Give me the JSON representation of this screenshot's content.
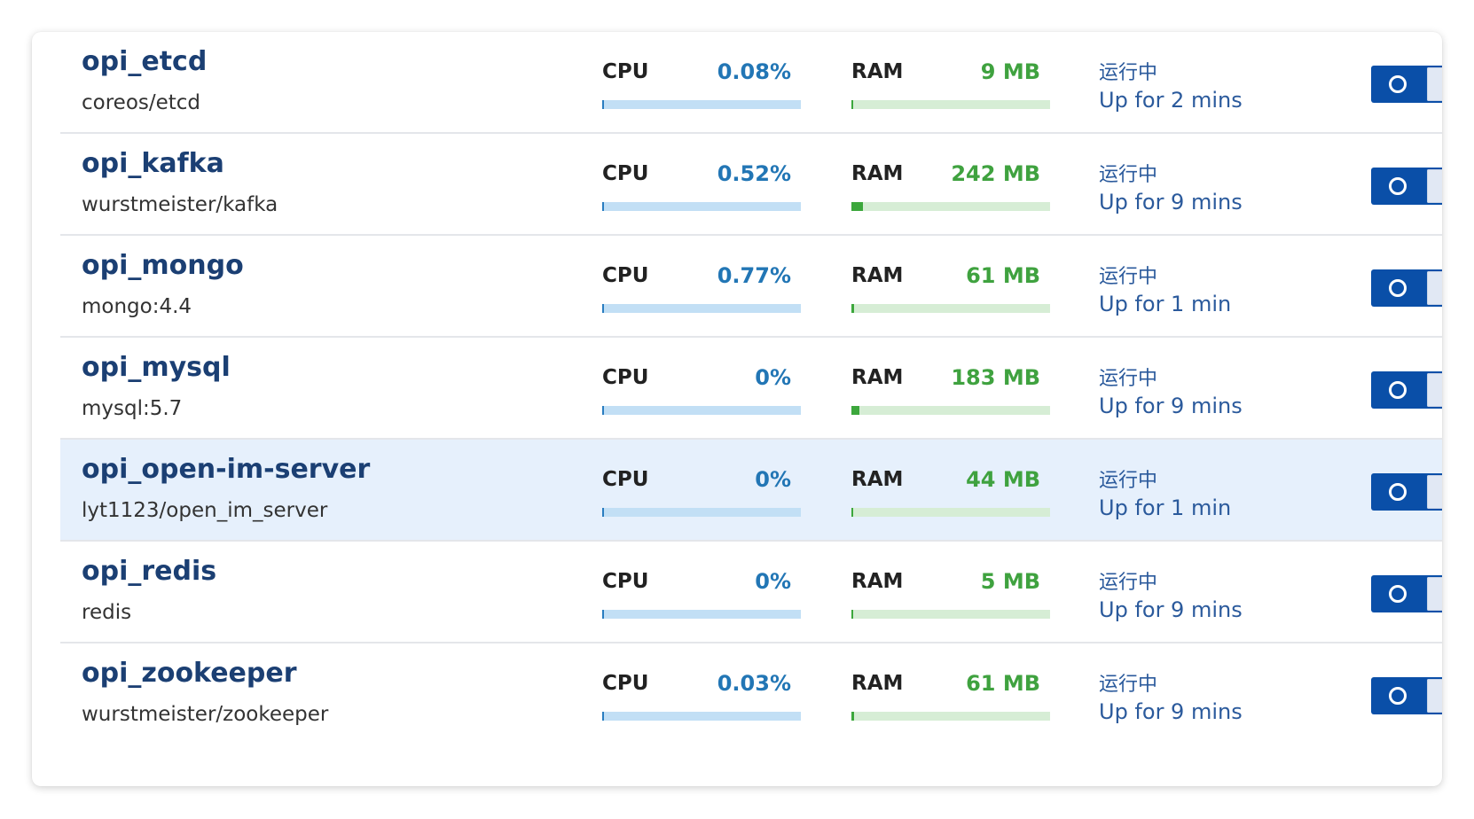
{
  "labels": {
    "cpu": "CPU",
    "ram": "RAM"
  },
  "colors": {
    "name": "#1b3f73",
    "cpu_value": "#2276b5",
    "ram_value": "#3fa23f",
    "status": "#2b5a9c",
    "toggle_on": "#0a4fa8",
    "row_highlight": "#e6f0fc"
  },
  "containers": [
    {
      "name": "opi_etcd",
      "image": "coreos/etcd",
      "cpu": "0.08%",
      "cpu_fraction": 0.0008,
      "ram": "9 MB",
      "ram_fraction": 0.005,
      "status": "运行中",
      "uptime": "Up for 2 mins",
      "running": true,
      "highlighted": false
    },
    {
      "name": "opi_kafka",
      "image": "wurstmeister/kafka",
      "cpu": "0.52%",
      "cpu_fraction": 0.0052,
      "ram": "242 MB",
      "ram_fraction": 0.06,
      "status": "运行中",
      "uptime": "Up for 9 mins",
      "running": true,
      "highlighted": false
    },
    {
      "name": "opi_mongo",
      "image": "mongo:4.4",
      "cpu": "0.77%",
      "cpu_fraction": 0.0077,
      "ram": "61 MB",
      "ram_fraction": 0.012,
      "status": "运行中",
      "uptime": "Up for 1 min",
      "running": true,
      "highlighted": false
    },
    {
      "name": "opi_mysql",
      "image": "mysql:5.7",
      "cpu": "0%",
      "cpu_fraction": 0,
      "ram": "183 MB",
      "ram_fraction": 0.04,
      "status": "运行中",
      "uptime": "Up for 9 mins",
      "running": true,
      "highlighted": false
    },
    {
      "name": "opi_open-im-server",
      "image": "lyt1123/open_im_server",
      "cpu": "0%",
      "cpu_fraction": 0,
      "ram": "44 MB",
      "ram_fraction": 0.008,
      "status": "运行中",
      "uptime": "Up for 1 min",
      "running": true,
      "highlighted": true
    },
    {
      "name": "opi_redis",
      "image": "redis",
      "cpu": "0%",
      "cpu_fraction": 0,
      "ram": "5 MB",
      "ram_fraction": 0.004,
      "status": "运行中",
      "uptime": "Up for 9 mins",
      "running": true,
      "highlighted": false
    },
    {
      "name": "opi_zookeeper",
      "image": "wurstmeister/zookeeper",
      "cpu": "0.03%",
      "cpu_fraction": 0.0003,
      "ram": "61 MB",
      "ram_fraction": 0.012,
      "status": "运行中",
      "uptime": "Up for 9 mins",
      "running": true,
      "highlighted": false
    }
  ]
}
